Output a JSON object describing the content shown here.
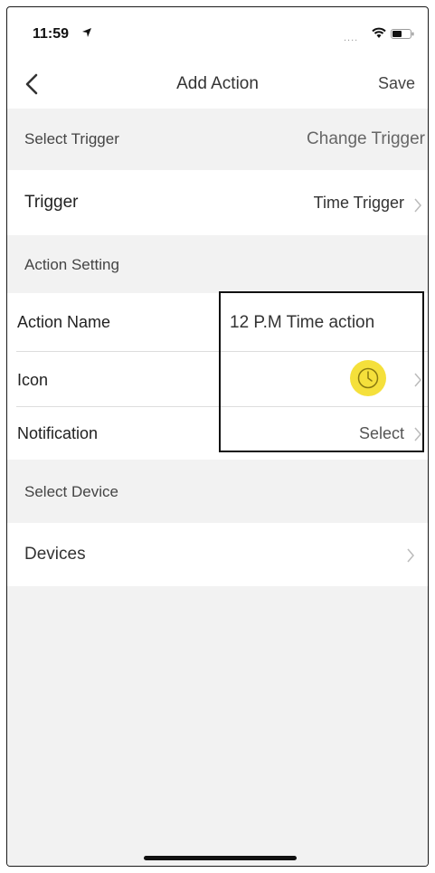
{
  "status_bar": {
    "time": "11:59",
    "signal_text": "....",
    "icons": [
      "location-arrow-icon",
      "wifi-icon",
      "battery-icon"
    ]
  },
  "nav": {
    "title": "Add Action",
    "save_label": "Save",
    "back_icon": "chevron-left-icon"
  },
  "select_trigger": {
    "label": "Select Trigger",
    "action_label": "Change Trigger"
  },
  "trigger_row": {
    "label": "Trigger",
    "value": "Time Trigger"
  },
  "action_setting": {
    "label": "Action Setting"
  },
  "action_name_row": {
    "label": "Action Name",
    "value": "12 P.M Time action"
  },
  "icon_row": {
    "label": "Icon",
    "selected_icon": "clock-icon",
    "icon_color": "#f5e03b"
  },
  "notification_row": {
    "label": "Notification",
    "value": "Select"
  },
  "select_device": {
    "label": "Select Device"
  },
  "devices_row": {
    "label": "Devices"
  }
}
